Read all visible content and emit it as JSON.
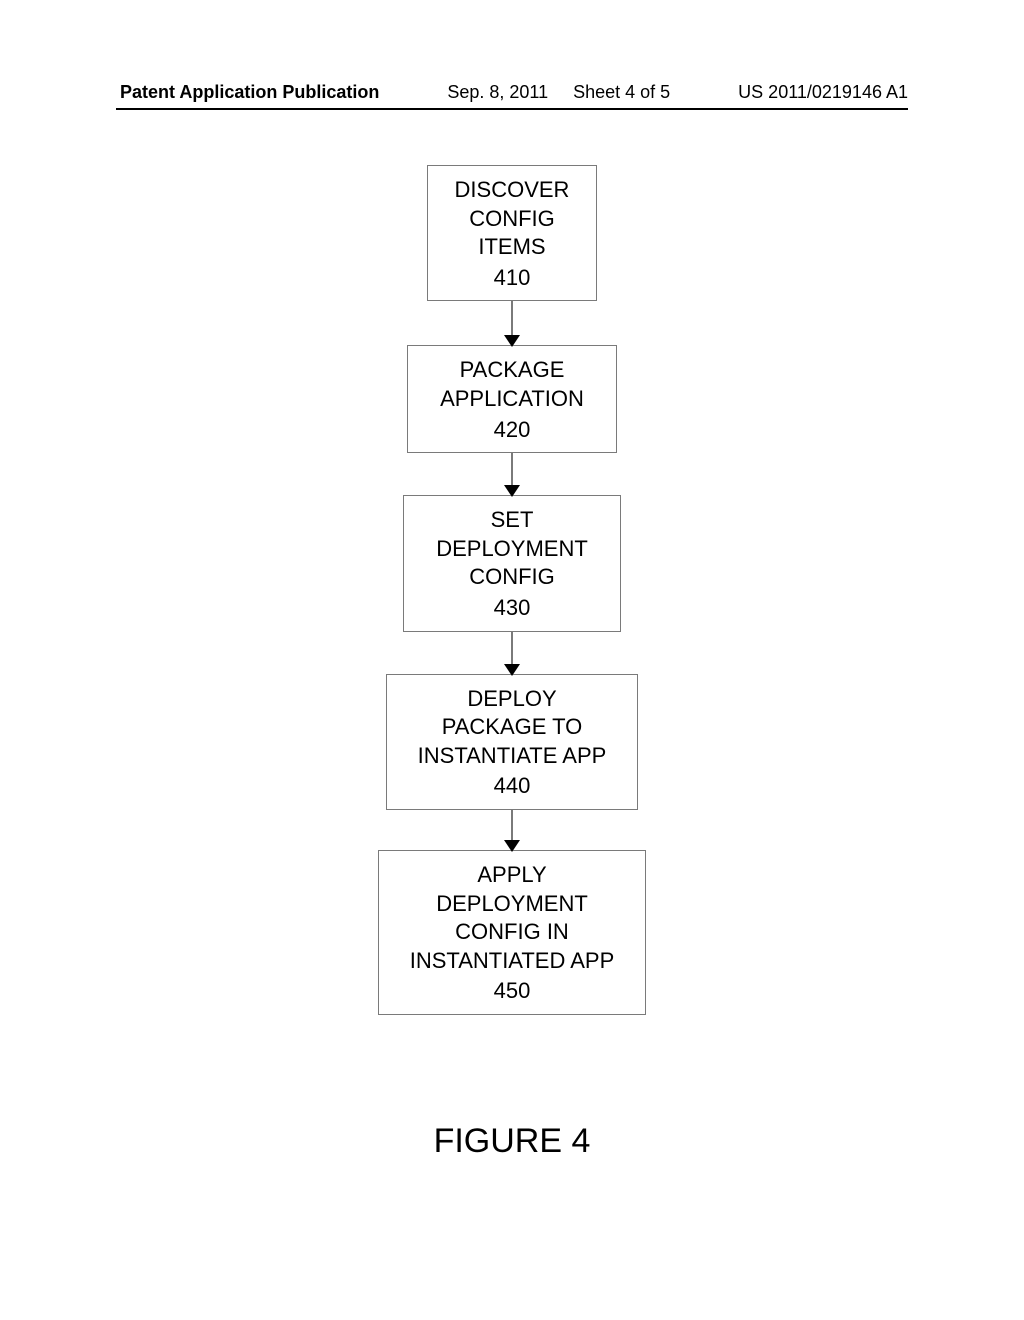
{
  "header": {
    "left": "Patent Application Publication",
    "mid_date": "Sep. 8, 2011",
    "mid_sheet": "Sheet 4 of 5",
    "right": "US 2011/0219146 A1"
  },
  "figure_label": "FIGURE 4",
  "chart_data": {
    "type": "flowchart",
    "direction": "top-to-bottom",
    "nodes": [
      {
        "id": "410",
        "lines": [
          "DISCOVER",
          "CONFIG",
          "ITEMS"
        ],
        "ref": "410"
      },
      {
        "id": "420",
        "lines": [
          "PACKAGE",
          "APPLICATION"
        ],
        "ref": "420"
      },
      {
        "id": "430",
        "lines": [
          "SET",
          "DEPLOYMENT",
          "CONFIG"
        ],
        "ref": "430"
      },
      {
        "id": "440",
        "lines": [
          "DEPLOY",
          "PACKAGE TO",
          "INSTANTIATE APP"
        ],
        "ref": "440"
      },
      {
        "id": "450",
        "lines": [
          "APPLY",
          "DEPLOYMENT",
          "CONFIG IN",
          "INSTANTIATED APP"
        ],
        "ref": "450"
      }
    ],
    "edges": [
      {
        "from": "410",
        "to": "420"
      },
      {
        "from": "420",
        "to": "430"
      },
      {
        "from": "430",
        "to": "440"
      },
      {
        "from": "440",
        "to": "450"
      }
    ]
  }
}
